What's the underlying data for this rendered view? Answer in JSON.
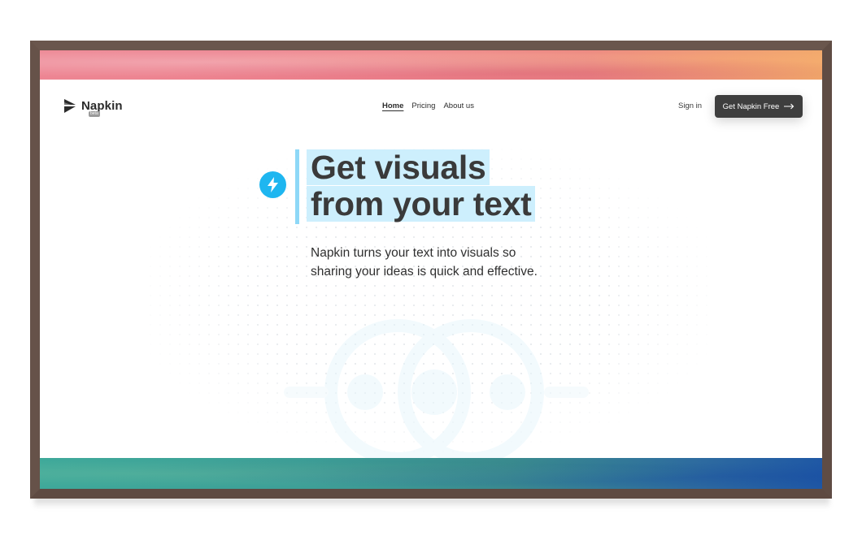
{
  "brand": {
    "name": "Napkin",
    "badge": "beta"
  },
  "nav": {
    "links": [
      {
        "label": "Home",
        "active": true
      },
      {
        "label": "Pricing",
        "active": false
      },
      {
        "label": "About us",
        "active": false
      }
    ],
    "sign_in": "Sign in",
    "cta_label": "Get Napkin Free",
    "cta_icon": "arrow-right-icon"
  },
  "hero": {
    "icon": "lightning-bolt-icon",
    "title_line1": "Get visuals",
    "title_line2": "from your text",
    "subtitle": "Napkin turns your text into visuals so sharing your ideas is quick and effective."
  },
  "colors": {
    "accent": "#1eb6f0",
    "highlight": "#cdeffd",
    "cta_bg": "#3e3e3e",
    "frame": "#6e5a51"
  }
}
